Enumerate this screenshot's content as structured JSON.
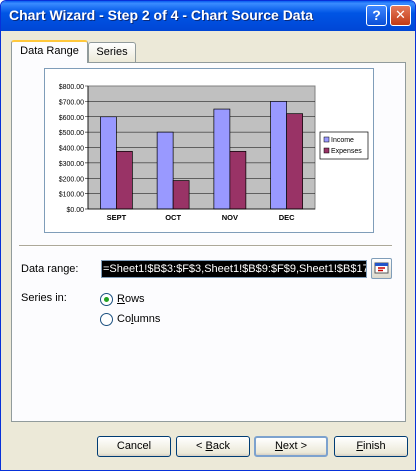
{
  "window": {
    "title": "Chart Wizard - Step 2 of 4 - Chart Source Data",
    "help_icon_glyph": "?",
    "close_icon_glyph": "✕"
  },
  "tabs": [
    {
      "label": "Data Range",
      "active": true
    },
    {
      "label": "Series",
      "active": false
    }
  ],
  "chart_data": {
    "type": "bar",
    "categories": [
      "SEPT",
      "OCT",
      "NOV",
      "DEC"
    ],
    "series": [
      {
        "name": "Income",
        "values": [
          600,
          500,
          650,
          700
        ],
        "color": "#9999ff"
      },
      {
        "name": "Expenses",
        "values": [
          375,
          185,
          375,
          620
        ],
        "color": "#993366"
      }
    ],
    "yticks": [
      "$0.00",
      "$100.00",
      "$200.00",
      "$300.00",
      "$400.00",
      "$500.00",
      "$600.00",
      "$700.00",
      "$800.00"
    ],
    "ylim": [
      0,
      800
    ],
    "grid": true,
    "legend_position": "right",
    "plot_background": "#c0c0c0"
  },
  "form": {
    "data_range_label": "Data range:",
    "data_range_value": "=Sheet1!$B$3:$F$3,Sheet1!$B$9:$F$9,Sheet1!$B$17",
    "series_in_label": "Series in:",
    "rows_first": "R",
    "rows_rest": "ows",
    "columns_first": "Co",
    "columns_u": "l",
    "columns_rest": "umns",
    "series_in_selected": "Rows"
  },
  "buttons": {
    "cancel": "Cancel",
    "back_prefix": "< ",
    "back_u": "B",
    "back_rest": "ack",
    "next_u": "N",
    "next_rest": "ext >",
    "finish_u": "F",
    "finish_rest": "inish"
  }
}
